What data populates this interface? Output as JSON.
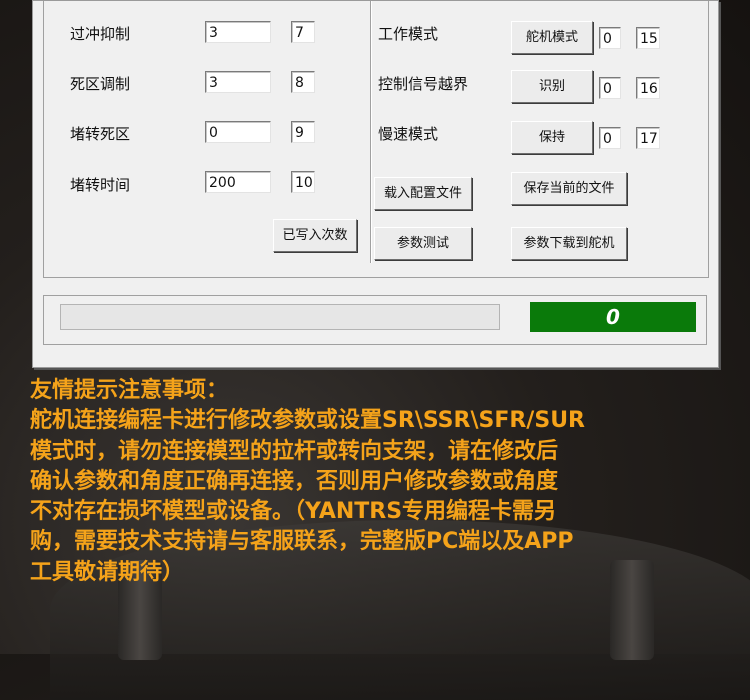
{
  "left_panel": {
    "rows": [
      {
        "label": "过冲抑制",
        "value": "3",
        "index": "7"
      },
      {
        "label": "死区调制",
        "value": "3",
        "index": "8"
      },
      {
        "label": "堵转死区",
        "value": "0",
        "index": "9"
      },
      {
        "label": "堵转时间",
        "value": "200",
        "index": "10"
      }
    ],
    "written_count_button": "已写入次数"
  },
  "right_panel": {
    "rows": [
      {
        "label": "工作模式",
        "button": "舵机模式",
        "value": "0",
        "index": "15"
      },
      {
        "label": "控制信号越界",
        "button": "识别",
        "value": "0",
        "index": "16"
      },
      {
        "label": "慢速模式",
        "button": "保持",
        "value": "0",
        "index": "17"
      }
    ],
    "load_config_button": "载入配置文件",
    "save_file_button": "保存当前的文件",
    "param_test_button": "参数测试",
    "download_button": "参数下载到舵机"
  },
  "status": {
    "progress": 0,
    "counter": "0",
    "progress_color": "#06b025",
    "counter_color": "#0a7a0a"
  },
  "notice": {
    "color": "#f5a31a",
    "lines": [
      "友情提示注意事项：",
      "舵机连接编程卡进行修改参数或设置SR\\SSR\\SFR/SUR",
      "模式时，请勿连接模型的拉杆或转向支架，请在修改后",
      "确认参数和角度正确再连接，否则用户修改参数或角度",
      "不对存在损坏模型或设备。（YANTRS专用编程卡需另",
      "购，需要技术支持请与客服联系，完整版PC端以及APP",
      "工具敬请期待）"
    ]
  }
}
